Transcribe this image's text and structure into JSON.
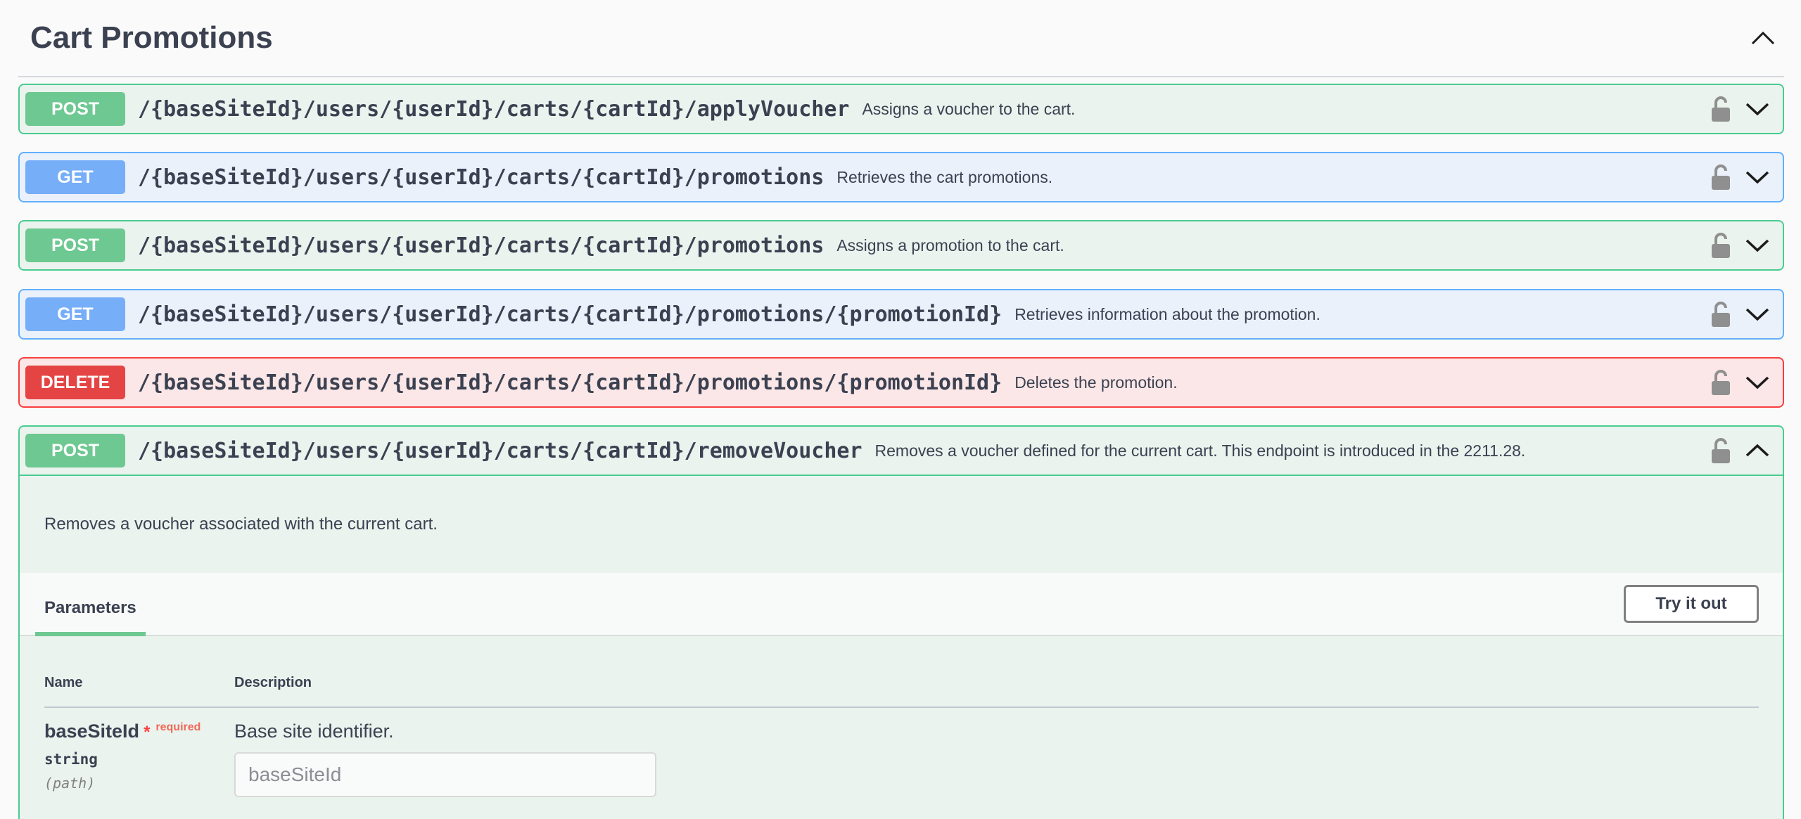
{
  "section": {
    "title": "Cart Promotions"
  },
  "operations": [
    {
      "method": "POST",
      "path": "/{baseSiteId}/users/{userId}/carts/{cartId}/applyVoucher",
      "summary": "Assigns a voucher to the cart."
    },
    {
      "method": "GET",
      "path": "/{baseSiteId}/users/{userId}/carts/{cartId}/promotions",
      "summary": "Retrieves the cart promotions."
    },
    {
      "method": "POST",
      "path": "/{baseSiteId}/users/{userId}/carts/{cartId}/promotions",
      "summary": "Assigns a promotion to the cart."
    },
    {
      "method": "GET",
      "path": "/{baseSiteId}/users/{userId}/carts/{cartId}/promotions/{promotionId}",
      "summary": "Retrieves information about the promotion."
    },
    {
      "method": "DELETE",
      "path": "/{baseSiteId}/users/{userId}/carts/{cartId}/promotions/{promotionId}",
      "summary": "Deletes the promotion."
    },
    {
      "method": "POST",
      "path": "/{baseSiteId}/users/{userId}/carts/{cartId}/removeVoucher",
      "summary": "Removes a voucher defined for the current cart. This endpoint is introduced in the 2211.28."
    }
  ],
  "expanded": {
    "description": "Removes a voucher associated with the current cart.",
    "parameters_tab": "Parameters",
    "try_button": "Try it out",
    "columns": {
      "name": "Name",
      "description": "Description"
    },
    "param": {
      "name": "baseSiteId",
      "required_star": "*",
      "required_label": "required",
      "type": "string",
      "in": "(path)",
      "description": "Base site identifier.",
      "placeholder": "baseSiteId"
    }
  },
  "colors": {
    "post": "#49cc90",
    "get": "#61affe",
    "delete": "#f93e3e"
  },
  "icons": {
    "lock": "lock-icon",
    "expand": "chevron-down-icon",
    "collapse": "chevron-up-icon"
  }
}
